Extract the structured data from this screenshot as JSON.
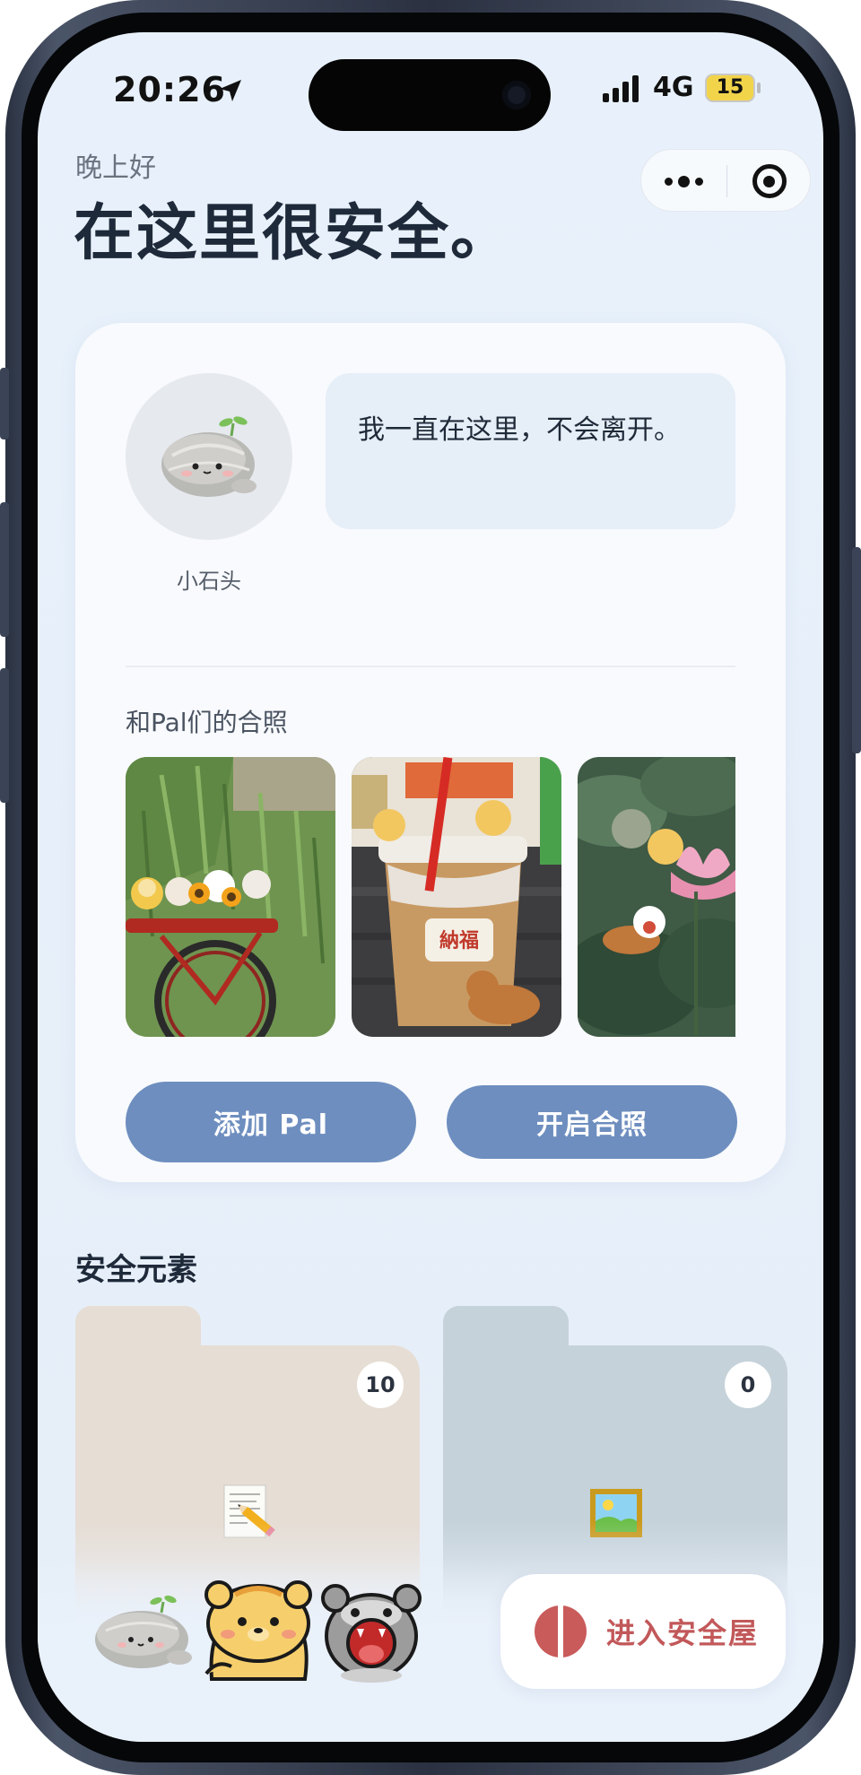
{
  "status_bar": {
    "time": "20:26",
    "network": "4G",
    "battery": "15"
  },
  "capsule": {
    "more_icon": "more-dots-icon",
    "close_icon": "target-circle-icon"
  },
  "greeting": {
    "subtitle": "晚上好",
    "title": "在这里很安全。"
  },
  "companion": {
    "name": "小石头",
    "message": "我一直在这里，不会离开。"
  },
  "photos": {
    "title": "和Pal们的合照",
    "items": [
      {
        "scene": "bicycle-with-sunflowers"
      },
      {
        "scene": "milk-tea-cup"
      },
      {
        "scene": "lotus-pond"
      }
    ]
  },
  "buttons": {
    "add_pal": "添加 Pal",
    "start_photo": "开启合照"
  },
  "safety": {
    "title": "安全元素",
    "folders": [
      {
        "icon": "memo-pencil-icon",
        "count": "10",
        "color": "#e6ddd4"
      },
      {
        "icon": "framed-picture-icon",
        "count": "0",
        "color": "#c5d2da"
      }
    ]
  },
  "bottom_bar": {
    "pals": [
      "stone-pal",
      "bear-pal",
      "gray-bear-pal"
    ],
    "enter_label": "进入安全屋",
    "enter_icon": "split-circle-icon"
  },
  "colors": {
    "background": "#e8f1fb",
    "card": "#f8fafd",
    "button": "#6e8ebf",
    "accent_red": "#c2585a"
  }
}
